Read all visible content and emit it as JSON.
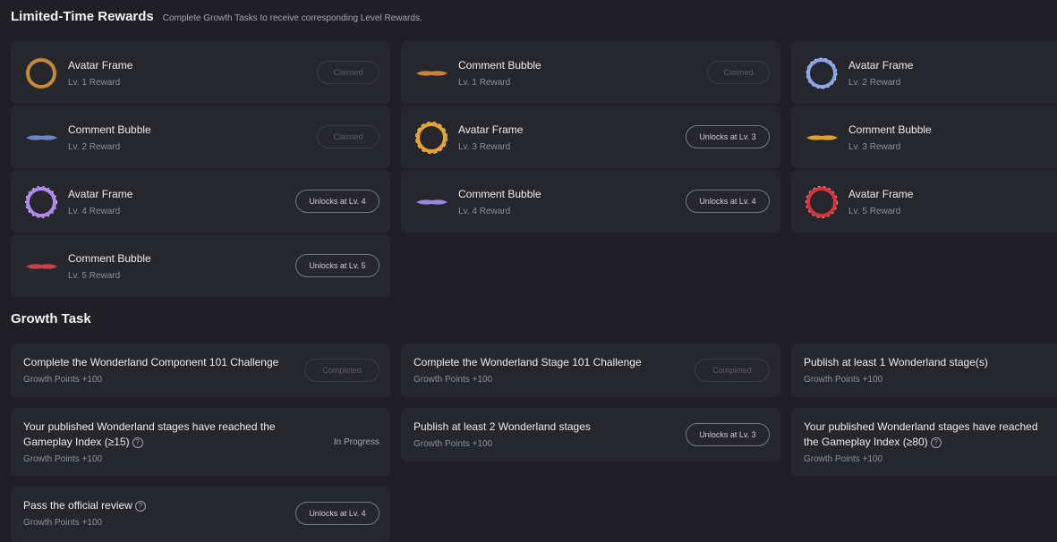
{
  "rewards_section": {
    "title": "Limited-Time Rewards",
    "subtitle": "Complete Growth Tasks to receive corresponding Level Rewards."
  },
  "rewards": [
    {
      "title": "Avatar Frame",
      "sub": "Lv. 1 Reward",
      "button": "Claimed",
      "icon": "ring-frame-icon",
      "color": "#c58a3b"
    },
    {
      "title": "Comment Bubble",
      "sub": "Lv. 1 Reward",
      "button": "Claimed",
      "icon": "bubble-icon",
      "color": "#c9833c"
    },
    {
      "title": "Avatar Frame",
      "sub": "Lv. 2 Reward",
      "button": "",
      "icon": "ring-frame-icon",
      "color": "#8aa6e6"
    },
    {
      "title": "Comment Bubble",
      "sub": "Lv. 2 Reward",
      "button": "Claimed",
      "icon": "bubble-icon",
      "color": "#6a88c8"
    },
    {
      "title": "Avatar Frame",
      "sub": "Lv. 3 Reward",
      "button": "Unlocks at Lv. 3",
      "icon": "ring-frame-icon",
      "color": "#e6a52a"
    },
    {
      "title": "Comment Bubble",
      "sub": "Lv. 3 Reward",
      "button": "",
      "icon": "bubble-icon",
      "color": "#d9a233"
    },
    {
      "title": "Avatar Frame",
      "sub": "Lv. 4 Reward",
      "button": "Unlocks at Lv. 4",
      "icon": "ring-frame-icon",
      "color": "#b08af0"
    },
    {
      "title": "Comment Bubble",
      "sub": "Lv. 4 Reward",
      "button": "Unlocks at Lv. 4",
      "icon": "bubble-icon",
      "color": "#9a88e0"
    },
    {
      "title": "Avatar Frame",
      "sub": "Lv. 5 Reward",
      "button": "",
      "icon": "ring-frame-icon",
      "color": "#d9343c"
    },
    {
      "title": "Comment Bubble",
      "sub": "Lv. 5 Reward",
      "button": "Unlocks at Lv. 5",
      "icon": "bubble-icon",
      "color": "#c8434b"
    }
  ],
  "tasks_section": {
    "title": "Growth Task"
  },
  "tasks": [
    {
      "title": "Complete the Wonderland Component 101 Challenge",
      "points": "Growth Points +100",
      "button": "Completed"
    },
    {
      "title": "Complete the Wonderland Stage 101 Challenge",
      "points": "Growth Points +100",
      "button": "Completed"
    },
    {
      "title": "Publish at least 1 Wonderland stage(s)",
      "points": "Growth Points +100",
      "button": ""
    },
    {
      "title": "Your published Wonderland stages have reached the",
      "title2": "Gameplay Index (≥15)",
      "points": "Growth Points +100",
      "status": "In Progress"
    },
    {
      "title": "Publish at least 2 Wonderland stages",
      "points": "Growth Points +100",
      "button": "Unlocks at Lv. 3"
    },
    {
      "title": "Your published Wonderland stages have reached",
      "title2": "the Gameplay Index (≥80)",
      "points": "Growth Points +100"
    },
    {
      "title": "Pass the official review",
      "points": "Growth Points +100",
      "button": "Unlocks at Lv. 4"
    }
  ],
  "help_glyph": "?"
}
